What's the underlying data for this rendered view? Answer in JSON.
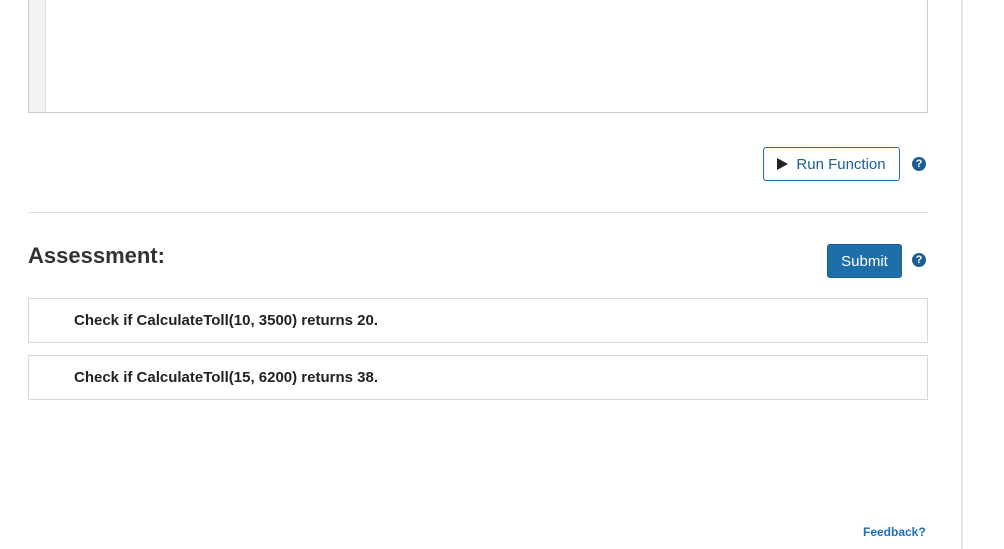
{
  "run": {
    "label": "Run Function",
    "icon": "play-icon"
  },
  "help": {
    "glyph": "?"
  },
  "assessment": {
    "title": "Assessment:",
    "submit_label": "Submit",
    "checks": [
      {
        "text": "Check if CalculateToll(10, 3500) returns 20."
      },
      {
        "text": "Check if CalculateToll(15, 6200) returns 38."
      }
    ]
  },
  "footer": {
    "feedback_label": "Feedback?"
  },
  "colors": {
    "accent": "#1e6ea7",
    "link": "#1a6fb8"
  }
}
